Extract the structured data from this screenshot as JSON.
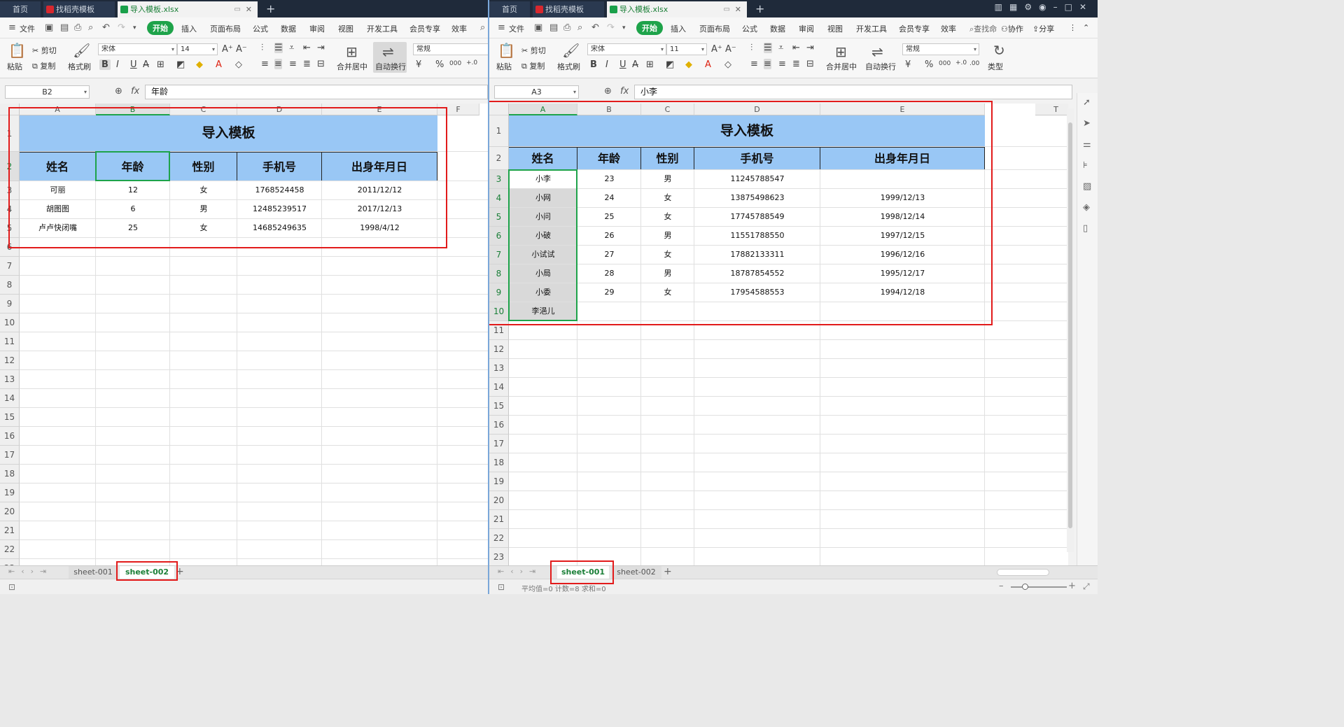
{
  "tabs": {
    "home": "首页",
    "templates": "找稻壳模板",
    "file": "导入模板.xlsx",
    "new_tab": "+"
  },
  "menu": {
    "file": "文件",
    "start": "开始",
    "insert": "插入",
    "layout": "页面布局",
    "formula": "公式",
    "data": "数据",
    "review": "审阅",
    "view": "视图",
    "dev": "开发工具",
    "member": "会员专享",
    "efficiency": "效率",
    "search": "查找命",
    "coop": "协作",
    "share": "分享"
  },
  "ribbon": {
    "paste": "粘贴",
    "cut": "剪切",
    "copy": "复制",
    "brush": "格式刷",
    "merge": "合并居中",
    "wrap": "自动换行",
    "type": "类型",
    "font": "宋体",
    "number_format": "常规"
  },
  "left": {
    "namebox": "B2",
    "formula": "年龄",
    "font_size": "14",
    "cols": [
      "A",
      "B",
      "C",
      "D",
      "E",
      "F"
    ],
    "rows": [
      "1",
      "2",
      "3",
      "4",
      "5",
      "6",
      "7",
      "8",
      "9",
      "10",
      "11",
      "12",
      "13",
      "14",
      "15",
      "16",
      "17",
      "18",
      "19",
      "20",
      "21",
      "22",
      "23"
    ],
    "title": "导入模板",
    "headers": [
      "姓名",
      "年龄",
      "性别",
      "手机号",
      "出身年月日"
    ],
    "data": [
      [
        "可丽",
        "12",
        "女",
        "1768524458",
        "2011/12/12"
      ],
      [
        "胡图图",
        "6",
        "男",
        "12485239517",
        "2017/12/13"
      ],
      [
        "卢卢快闭嘴",
        "25",
        "女",
        "14685249635",
        "1998/4/12"
      ]
    ],
    "sheets": [
      "sheet-001",
      "sheet-002"
    ],
    "active_sheet": "sheet-002"
  },
  "right": {
    "namebox": "A3",
    "formula": "小李",
    "font_size": "11",
    "cols": [
      "A",
      "B",
      "C",
      "D",
      "E",
      "T"
    ],
    "rows": [
      "1",
      "2",
      "3",
      "4",
      "5",
      "6",
      "7",
      "8",
      "9",
      "10",
      "11",
      "12",
      "13",
      "14",
      "15",
      "16",
      "17",
      "18",
      "19",
      "20",
      "21",
      "22",
      "23"
    ],
    "title": "导入模板",
    "headers": [
      "姓名",
      "年龄",
      "性别",
      "手机号",
      "出身年月日"
    ],
    "data": [
      [
        "小李",
        "23",
        "男",
        "11245788547",
        ""
      ],
      [
        "小网",
        "24",
        "女",
        "13875498623",
        "1999/12/13"
      ],
      [
        "小问",
        "25",
        "女",
        "17745788549",
        "1998/12/14"
      ],
      [
        "小破",
        "26",
        "男",
        "11551788550",
        "1997/12/15"
      ],
      [
        "小试试",
        "27",
        "女",
        "17882133311",
        "1996/12/16"
      ],
      [
        "小局",
        "28",
        "男",
        "18787854552",
        "1995/12/17"
      ],
      [
        "小委",
        "29",
        "女",
        "17954588553",
        "1994/12/18"
      ],
      [
        "李浥儿",
        "",
        "",
        "",
        ""
      ]
    ],
    "sheets": [
      "sheet-001",
      "sheet-002"
    ],
    "active_sheet": "sheet-001",
    "status": "平均值=0  计数=8  求和=0"
  }
}
